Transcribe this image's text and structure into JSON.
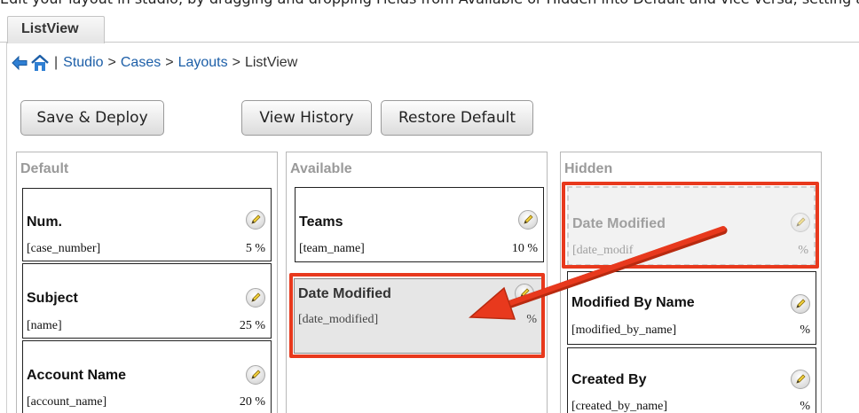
{
  "window": {
    "top_text": "Edit your layout in studio, by dragging and dropping Fields from Available or Hidden into Default and vice versa, setting any fields to display or display as hidden"
  },
  "tabs": [
    {
      "label": "ListView"
    }
  ],
  "breadcrumb": {
    "separator": "|",
    "items": [
      {
        "label": "Studio"
      },
      {
        "label": "Cases"
      },
      {
        "label": "Layouts"
      },
      {
        "label": "ListView"
      }
    ],
    "arrow": ">"
  },
  "toolbar": {
    "save_deploy_label": "Save & Deploy",
    "view_history_label": "View History",
    "restore_default_label": "Restore Default"
  },
  "columns": {
    "default": {
      "heading": "Default",
      "cards": [
        {
          "title": "Num.",
          "field": "[case_number]",
          "width": "5 %"
        },
        {
          "title": "Subject",
          "field": "[name]",
          "width": "25 %"
        },
        {
          "title": "Account Name",
          "field": "[account_name]",
          "width": "20 %"
        }
      ]
    },
    "available": {
      "heading": "Available",
      "cards": [
        {
          "title": "Teams",
          "field": "[team_name]",
          "width": "10 %"
        }
      ],
      "dragging": {
        "title": "Date Modified",
        "field": "[date_modified]",
        "width": "%"
      }
    },
    "hidden": {
      "heading": "Hidden",
      "ghost": {
        "title": "Date Modified",
        "field": "[date_modif",
        "width": "%"
      },
      "cards": [
        {
          "title": "Modified By Name",
          "field": "[modified_by_name]",
          "width": "%"
        },
        {
          "title": "Created By",
          "field": "[created_by_name]",
          "width": "%"
        }
      ]
    }
  },
  "annotation_color": "#e8391d",
  "icons": [
    "back-arrow-icon",
    "home-icon",
    "pencil-edit-icon"
  ]
}
